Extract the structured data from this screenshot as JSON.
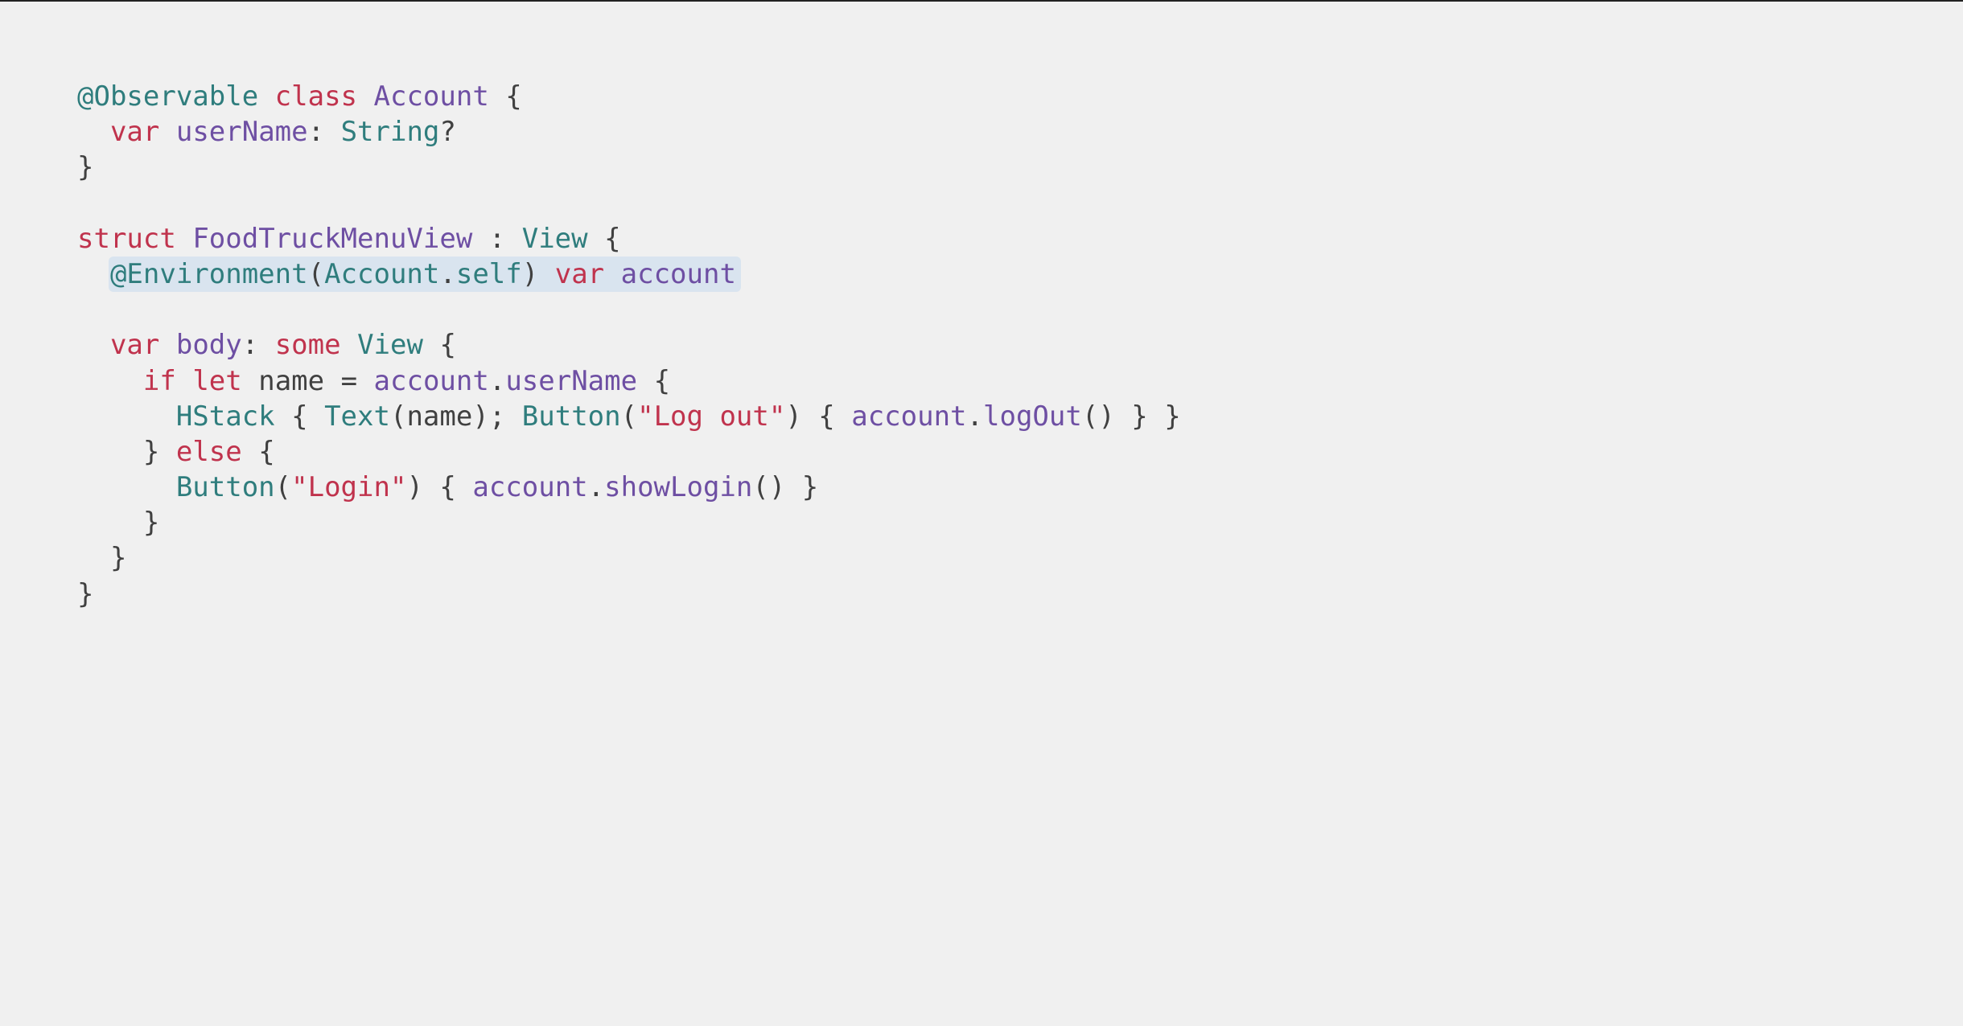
{
  "code": {
    "l1": {
      "attr": "@Observable",
      "kw_class": "class",
      "type_account": "Account",
      "brace": " {"
    },
    "l2": {
      "indent": "  ",
      "kw_var": "var",
      "ident_userName": "userName",
      "colon": ": ",
      "type_string": "String",
      "opt": "?"
    },
    "l3": {
      "brace": "}"
    },
    "l5": {
      "kw_struct": "struct",
      "type_foodtruck": "FoodTruckMenuView",
      "colon": " : ",
      "type_view": "View",
      "brace": " {"
    },
    "l6": {
      "indent": "  ",
      "attr_env": "@Environment",
      "paren_o": "(",
      "type_account": "Account",
      "dot": ".",
      "self": "self",
      "paren_c": ")",
      "sp": " ",
      "kw_var": "var",
      "sp2": " ",
      "ident_account": "account"
    },
    "l8": {
      "indent": "  ",
      "kw_var": "var",
      "sp": " ",
      "ident_body": "body",
      "colon": ": ",
      "kw_some": "some",
      "sp2": " ",
      "type_view": "View",
      "brace": " {"
    },
    "l9": {
      "indent": "    ",
      "kw_if": "if",
      "sp": " ",
      "kw_let": "let",
      "sp2": " ",
      "ident_name": "name",
      "eq": " = ",
      "ident_account": "account",
      "dot": ".",
      "ident_userName": "userName",
      "brace": " {"
    },
    "l10": {
      "indent": "      ",
      "type_hstack": "HStack",
      "sp": " { ",
      "type_text": "Text",
      "paren_o": "(",
      "ident_name": "name",
      "paren_c": ")",
      "semi": "; ",
      "type_button": "Button",
      "paren_o2": "(",
      "str_logout": "\"Log out\"",
      "paren_c2": ")",
      "sp2": " { ",
      "ident_account": "account",
      "dot": ".",
      "ident_logOut": "logOut",
      "call": "()",
      "close": " } }"
    },
    "l11": {
      "indent": "    ",
      "brace_c": "} ",
      "kw_else": "else",
      "brace_o": " {"
    },
    "l12": {
      "indent": "      ",
      "type_button": "Button",
      "paren_o": "(",
      "str_login": "\"Login\"",
      "paren_c": ")",
      "sp": " { ",
      "ident_account": "account",
      "dot": ".",
      "ident_showLogin": "showLogin",
      "call": "()",
      "close": " }"
    },
    "l13": {
      "indent": "    ",
      "brace": "}"
    },
    "l14": {
      "indent": "  ",
      "brace": "}"
    },
    "l15": {
      "brace": "}"
    }
  }
}
